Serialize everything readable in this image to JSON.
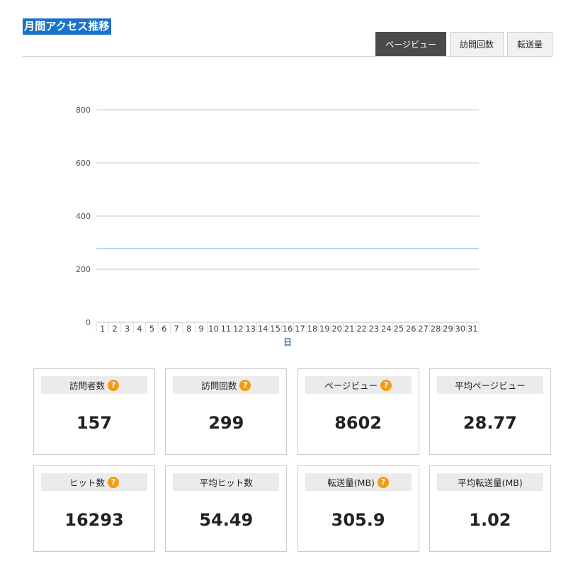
{
  "title": "月間アクセス推移",
  "tabs": [
    {
      "label": "ページビュー",
      "active": true
    },
    {
      "label": "訪問回数",
      "active": false
    },
    {
      "label": "転送量",
      "active": false
    }
  ],
  "colors": {
    "title_bg": "#1a73c9",
    "tab_active_bg": "#4a4a4a",
    "series_line": "#a8d4e6",
    "help_icon": "#f39c12",
    "axis_label": "#3d6fa5"
  },
  "chart_data": {
    "type": "line",
    "xlabel": "日",
    "ylabel": "",
    "ylim": [
      0,
      800
    ],
    "yticks": [
      0,
      200,
      400,
      600,
      800
    ],
    "grid": true,
    "categories": [
      "1",
      "2",
      "3",
      "4",
      "5",
      "6",
      "7",
      "8",
      "9",
      "10",
      "11",
      "12",
      "13",
      "14",
      "15",
      "16",
      "17",
      "18",
      "19",
      "20",
      "21",
      "22",
      "23",
      "24",
      "25",
      "26",
      "27",
      "28",
      "29",
      "30",
      "31"
    ],
    "series": [
      {
        "values": [
          278,
          278,
          278,
          278,
          278,
          278,
          278,
          278,
          278,
          278,
          278,
          278,
          278,
          278,
          278,
          278,
          278,
          278,
          278,
          278,
          278,
          278,
          278,
          278,
          278,
          278,
          278,
          278,
          278,
          278,
          278
        ]
      }
    ]
  },
  "stats": [
    {
      "label": "訪問者数",
      "value": "157",
      "help": true
    },
    {
      "label": "訪問回数",
      "value": "299",
      "help": true
    },
    {
      "label": "ページビュー",
      "value": "8602",
      "help": true
    },
    {
      "label": "平均ページビュー",
      "value": "28.77",
      "help": false
    },
    {
      "label": "ヒット数",
      "value": "16293",
      "help": true
    },
    {
      "label": "平均ヒット数",
      "value": "54.49",
      "help": false
    },
    {
      "label": "転送量(MB)",
      "value": "305.9",
      "help": true
    },
    {
      "label": "平均転送量(MB)",
      "value": "1.02",
      "help": false
    }
  ],
  "help_glyph": "?"
}
